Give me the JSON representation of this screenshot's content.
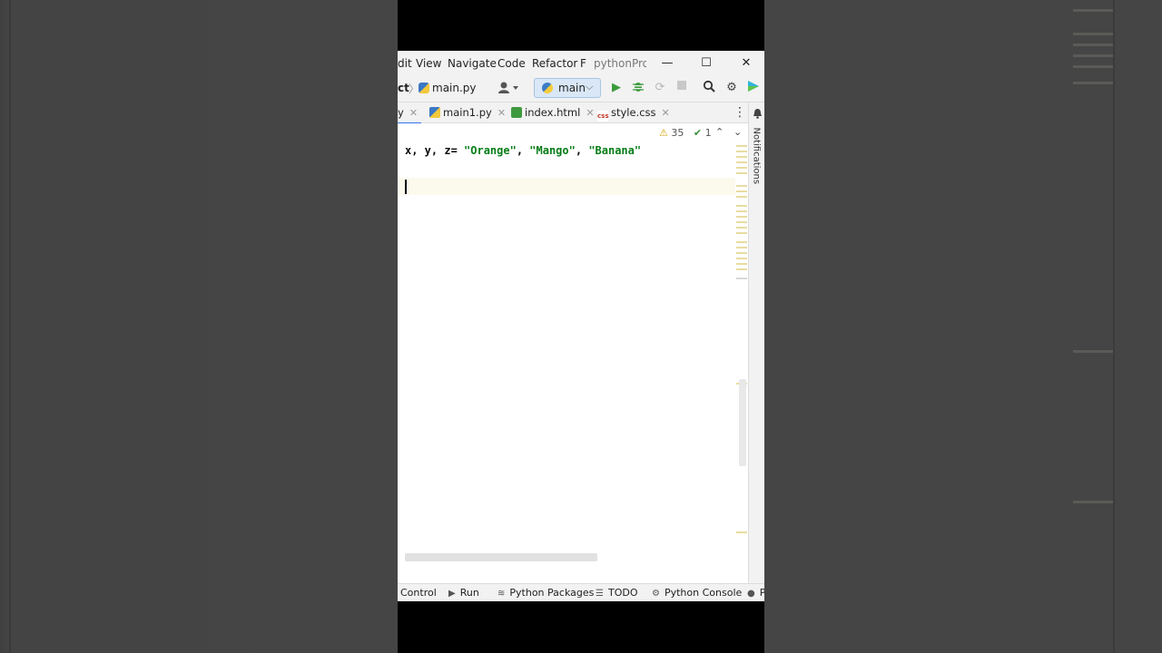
{
  "menubar": {
    "items": [
      "dit",
      "View",
      "Navigate",
      "Code",
      "Refactor",
      "F"
    ],
    "window_title": "pythonProject",
    "minimize": "—",
    "maximize": "☐",
    "close": "✕"
  },
  "toolbar": {
    "breadcrumb_project": "ct",
    "breadcrumb_file": "main.py",
    "run_config": "main"
  },
  "tabs": [
    {
      "label": "y",
      "active": true
    },
    {
      "label": "main1.py",
      "active": false
    },
    {
      "label": "index.html",
      "active": false
    },
    {
      "label": "style.css",
      "active": false
    }
  ],
  "editor": {
    "warnings_count": "35",
    "ok_count": "1",
    "code": {
      "prefix": "x, y, z= ",
      "s1": "\"Orange\"",
      "sep1": ", ",
      "s2": "\"Mango\"",
      "sep2": ", ",
      "s3": "\"Banana\""
    }
  },
  "side_panel": {
    "notifications_label": "Notifications"
  },
  "bottombar": {
    "items": [
      "Control",
      "Run",
      "Python Packages",
      "TODO",
      "Python Console",
      "P"
    ]
  },
  "colors": {
    "accent": "#3574f0",
    "string": "#067d17",
    "run_green": "#3b9c3b"
  }
}
